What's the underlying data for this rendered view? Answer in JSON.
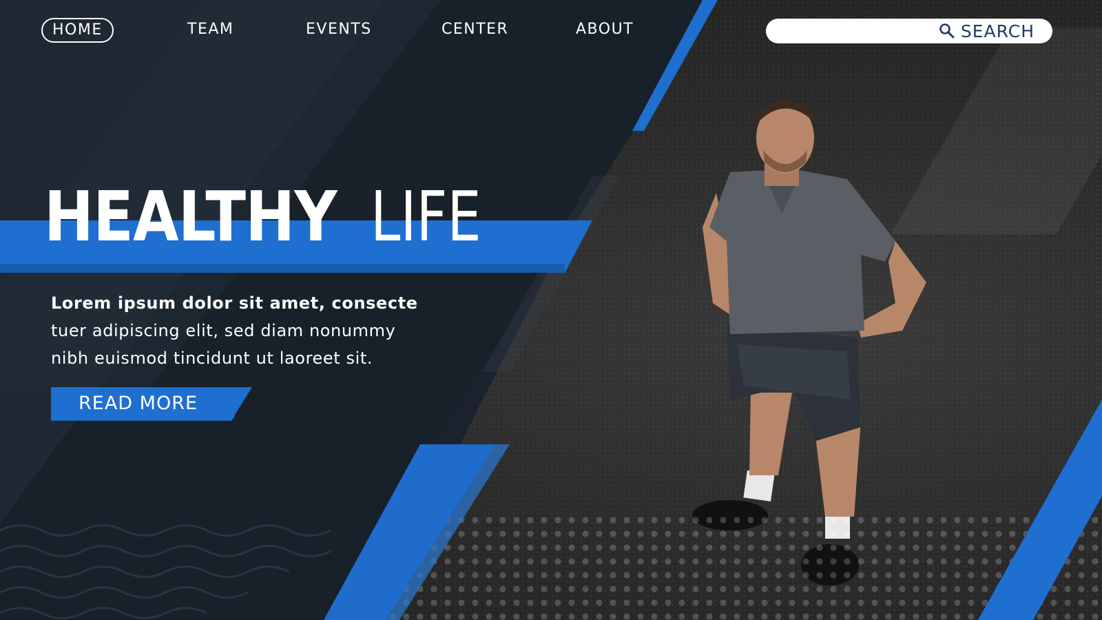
{
  "nav": {
    "items": [
      {
        "label": "HOME",
        "active": true
      },
      {
        "label": "TEAM",
        "active": false
      },
      {
        "label": "EVENTS",
        "active": false
      },
      {
        "label": "CENTER",
        "active": false
      },
      {
        "label": "ABOUT",
        "active": false
      }
    ]
  },
  "search": {
    "placeholder": "",
    "button_label": "SEARCH",
    "icon": "search-icon"
  },
  "hero": {
    "title_bold": "HEALTHY",
    "title_light": "LIFE",
    "lead": "Lorem ipsum dolor sit amet, consecte",
    "line2": "tuer adipiscing elit, sed diam nonummy",
    "line3": "nibh euismod tincidunt ut laoreet sit.",
    "cta_label": "READ MORE"
  },
  "colors": {
    "accent": "#1e6fd0",
    "panel_dark": "#182029",
    "text": "#ffffff",
    "search_text": "#1f3a66"
  }
}
